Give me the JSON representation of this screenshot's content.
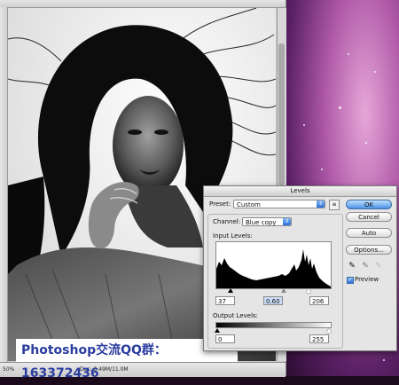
{
  "document": {
    "zoom": "50%",
    "doc_info": "Doc: 5.49M/11.0M"
  },
  "watermark": {
    "text": "Photoshop交流QQ群：163372436"
  },
  "levels": {
    "title": "Levels",
    "preset_label": "Preset:",
    "preset_value": "Custom",
    "channel_label": "Channel:",
    "channel_value": "Blue copy",
    "input_levels_label": "Input Levels:",
    "input_black": "37",
    "input_gamma": "0.60",
    "input_white": "206",
    "output_levels_label": "Output Levels:",
    "output_black": "0",
    "output_white": "255",
    "buttons": {
      "ok": "OK",
      "cancel": "Cancel",
      "auto": "Auto",
      "options": "Options..."
    },
    "preview_label": "Preview",
    "preview_checked": true
  }
}
